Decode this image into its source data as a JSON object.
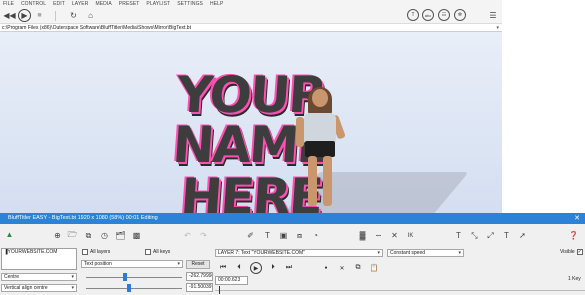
{
  "menu": [
    "FILE",
    "CONTROL",
    "EDIT",
    "LAYER",
    "MEDIA",
    "PRESET",
    "PLAYLIST",
    "SETTINGS",
    "HELP"
  ],
  "toolbar": {
    "right_icons": [
      "T",
      "abc",
      "",
      ""
    ]
  },
  "pathbar": {
    "path": "c:\\Program Files (x86)\\Outerspace Software\\BluffTitler\\Media\\Shows\\Mirror\\BigText.bt"
  },
  "viewport": {
    "line1": "YOUR",
    "line2": "NAME",
    "line3": "HERE"
  },
  "window": {
    "title": "BluffTitler EASY - BigText.bt 1920 x 1080 (58%) 00:01 Editing",
    "close": "✕"
  },
  "panel": {
    "text_value": "▐YOURWEBSITE.COM",
    "all_layers_label": "All layers",
    "all_keys_label": "All keys",
    "property_select": "Text position",
    "reset_label": "Reset",
    "align_select": "Centre",
    "valign_select": "Vertical align centre",
    "value_x": "-262.79998",
    "value_y": "-91.500397",
    "layer_select": "LAYER 7: Text \"YOURWEBSITE.COM\"",
    "speed_select": "Constant speed",
    "time_value": "00:00.623",
    "visible_label": "Visible",
    "key_label": "1 Key",
    "toolbar_texts": [
      "T",
      "T",
      "T",
      "IK"
    ]
  },
  "colors": {
    "titlebar": "#2b82d6",
    "accent_slider": "#2b7bd8",
    "text_highlight": "#ff4fb3"
  }
}
